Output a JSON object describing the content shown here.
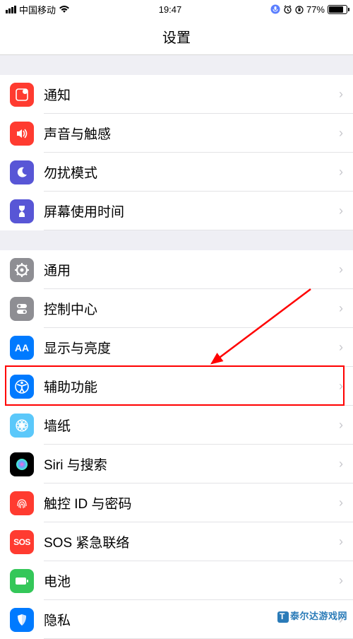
{
  "status": {
    "carrier": "中国移动",
    "time": "19:47",
    "battery_pct": "77%"
  },
  "nav": {
    "title": "设置"
  },
  "group1": [
    {
      "id": "notifications",
      "label": "通知",
      "icon_name": "notifications-icon",
      "icon_bg": "#ff3b30"
    },
    {
      "id": "sounds",
      "label": "声音与触感",
      "icon_name": "sounds-icon",
      "icon_bg": "#ff3b30"
    },
    {
      "id": "dnd",
      "label": "勿扰模式",
      "icon_name": "dnd-icon",
      "icon_bg": "#5856d6"
    },
    {
      "id": "screentime",
      "label": "屏幕使用时间",
      "icon_name": "screentime-icon",
      "icon_bg": "#5856d6"
    }
  ],
  "group2": [
    {
      "id": "general",
      "label": "通用",
      "icon_name": "gear-icon",
      "icon_bg": "#8e8e93"
    },
    {
      "id": "control-center",
      "label": "控制中心",
      "icon_name": "control-center-icon",
      "icon_bg": "#8e8e93"
    },
    {
      "id": "display",
      "label": "显示与亮度",
      "icon_name": "display-icon",
      "icon_bg": "#007aff"
    },
    {
      "id": "accessibility",
      "label": "辅助功能",
      "icon_name": "accessibility-icon",
      "icon_bg": "#007aff"
    },
    {
      "id": "wallpaper",
      "label": "墙纸",
      "icon_name": "wallpaper-icon",
      "icon_bg": "#5bc8fa"
    },
    {
      "id": "siri",
      "label": "Siri 与搜索",
      "icon_name": "siri-icon",
      "icon_bg": "#000000"
    },
    {
      "id": "touchid",
      "label": "触控 ID 与密码",
      "icon_name": "touchid-icon",
      "icon_bg": "#ff3b30"
    },
    {
      "id": "sos",
      "label": "SOS 紧急联络",
      "icon_name": "sos-icon",
      "icon_bg": "#ff3b30",
      "sos_text": "SOS"
    },
    {
      "id": "battery",
      "label": "电池",
      "icon_name": "battery-icon",
      "icon_bg": "#34c759"
    },
    {
      "id": "privacy",
      "label": "隐私",
      "icon_name": "privacy-icon",
      "icon_bg": "#007aff"
    }
  ],
  "annotation": {
    "highlighted_row_id": "accessibility"
  },
  "watermark": {
    "text": "泰尔达游戏网"
  }
}
